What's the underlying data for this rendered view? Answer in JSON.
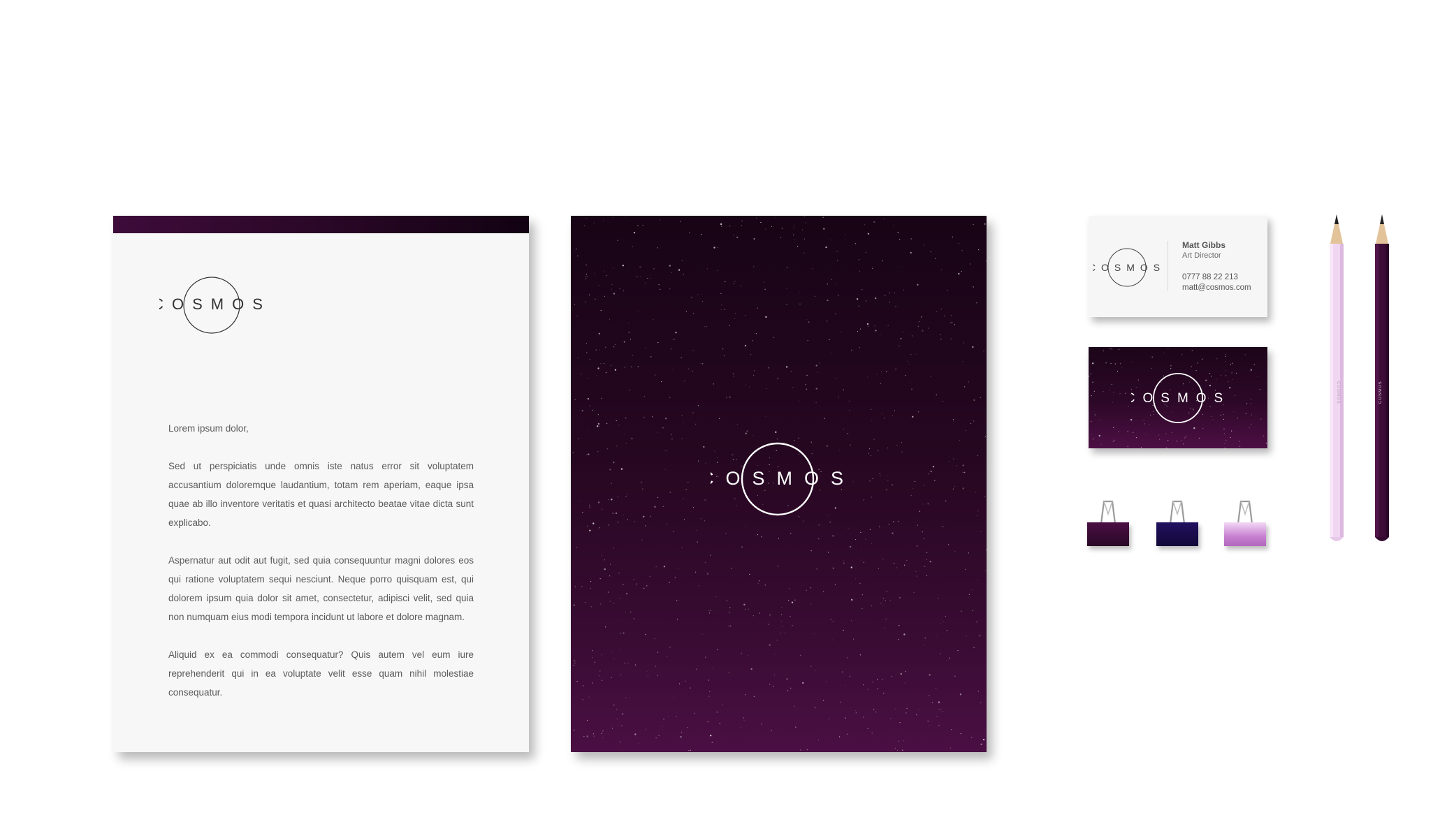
{
  "brand": {
    "name": "COSMOS",
    "colors": {
      "deep_purple": "#2a0727",
      "plum": "#4a0f43",
      "navy": "#1a0b45",
      "lilac": "#f0d6f2",
      "paper": "#f7f7f7"
    }
  },
  "letterhead": {
    "greeting": "Lorem ipsum dolor,",
    "paragraphs": [
      "Sed ut perspiciatis unde omnis iste natus error sit voluptatem accusantium doloremque laudantium, totam rem aperiam, eaque ipsa quae ab illo inventore veritatis et quasi architecto beatae vitae dicta sunt explicabo.",
      "Aspernatur aut odit aut fugit, sed quia consequuntur magni dolores eos qui ratione voluptatem sequi nesciunt. Neque porro quisquam est, qui dolorem ipsum quia dolor sit amet, consectetur, adipisci velit, sed quia non numquam eius modi tempora incidunt ut labore et dolore magnam.",
      "Aliquid ex ea commodi consequatur? Quis autem vel eum iure reprehenderit qui in ea voluptate velit esse quam nihil molestiae consequatur."
    ]
  },
  "business_card": {
    "name": "Matt Gibbs",
    "role": "Art Director",
    "phone": "0777 88 22 213",
    "email": "matt@cosmos.com"
  },
  "binder_clips": [
    {
      "color": "#3c0c36",
      "style": "solid"
    },
    {
      "color": "#1a0b45",
      "style": "solid"
    },
    {
      "color": "#e6b5ea",
      "style": "gradient"
    }
  ],
  "pencils": [
    {
      "color": "#f0d6f2",
      "label_color": "#b89ab8"
    },
    {
      "color": "#3d0d37",
      "label_color": "#e8c8ea"
    }
  ],
  "icons": [
    "cosmos-logo-icon"
  ]
}
